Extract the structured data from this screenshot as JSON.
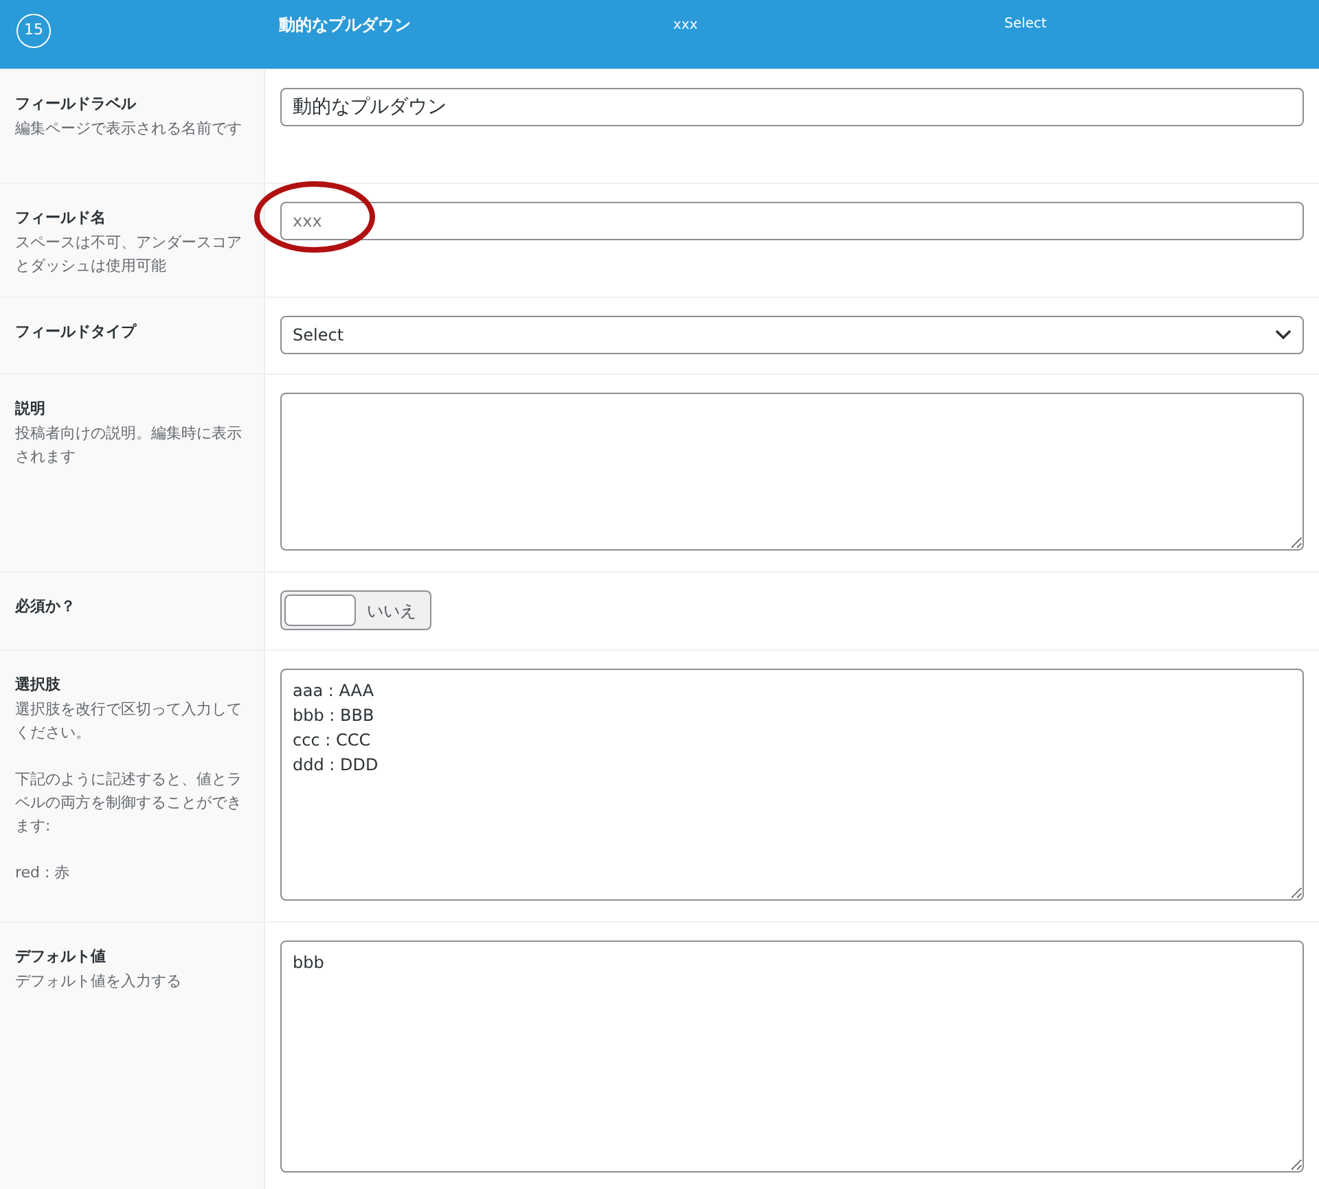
{
  "header": {
    "order": "15",
    "label": "動的なプルダウン",
    "name": "xxx",
    "type": "Select"
  },
  "rows": [
    {
      "kind": "text",
      "label": "フィールドラベル",
      "help": [
        "編集ページで表示される名前です"
      ],
      "value": "動的なプルダウン"
    },
    {
      "kind": "text",
      "label": "フィールド名",
      "help": [
        "スペースは不可、アンダースコアとダッシュは使用可能"
      ],
      "value": "xxx",
      "highlighted": true
    },
    {
      "kind": "select",
      "label": "フィールドタイプ",
      "value": "Select"
    },
    {
      "kind": "textarea",
      "label": "説明",
      "help": [
        "投稿者向けの説明。編集時に表示されます"
      ],
      "value": ""
    },
    {
      "kind": "toggle",
      "label": "必須か？",
      "on": false,
      "value": "いいえ"
    },
    {
      "kind": "textarea",
      "label": "選択肢",
      "help": [
        "選択肢を改行で区切って入力してください。",
        "下記のように記述すると、値とラベルの両方を制御することができます:",
        "red : 赤"
      ],
      "value": "aaa : AAA\nbbb : BBB\nccc : CCC\nddd : DDD"
    },
    {
      "kind": "textarea",
      "label": "デフォルト値",
      "help": [
        "デフォルト値を入力する"
      ],
      "value": "bbb"
    }
  ]
}
